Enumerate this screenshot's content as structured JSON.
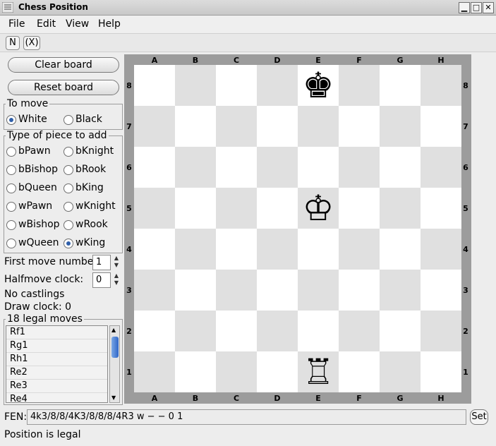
{
  "window": {
    "title": "Chess Position",
    "controls": [
      "▁",
      "□",
      "✕"
    ]
  },
  "menu": [
    "File",
    "Edit",
    "View",
    "Help"
  ],
  "toolbar": {
    "new_label": "N",
    "close_label": "(X)"
  },
  "left": {
    "clear_board": "Clear board",
    "reset_board": "Reset board",
    "to_move": {
      "title": "To move",
      "options": [
        "White",
        "Black"
      ],
      "selected": "White"
    },
    "piece_group": {
      "title": "Type of piece to add",
      "options": [
        "bPawn",
        "bKnight",
        "bBishop",
        "bRook",
        "bQueen",
        "bKing",
        "wPawn",
        "wKnight",
        "wBishop",
        "wRook",
        "wQueen",
        "wKing"
      ],
      "selected": "wKing"
    },
    "first_move_label": "First move number:",
    "first_move_value": "1",
    "halfmove_label": "Halfmove clock:",
    "halfmove_value": "0",
    "castlings": "No castlings",
    "draw_clock": "Draw clock:  0",
    "legal_moves": {
      "title": "18 legal moves",
      "items": [
        "Rf1",
        "Rg1",
        "Rh1",
        "Re2",
        "Re3",
        "Re4"
      ]
    }
  },
  "board": {
    "files": [
      "A",
      "B",
      "C",
      "D",
      "E",
      "F",
      "G",
      "H"
    ],
    "ranks": [
      "8",
      "7",
      "6",
      "5",
      "4",
      "3",
      "2",
      "1"
    ],
    "pieces": [
      {
        "square": "e8",
        "glyph": "♚",
        "name": "black-king"
      },
      {
        "square": "e5",
        "glyph": "♔",
        "name": "white-king"
      },
      {
        "square": "e1",
        "glyph": "♖",
        "name": "white-rook"
      }
    ]
  },
  "bottom": {
    "fen_label": "FEN:",
    "fen_value": "4k3/8/8/4K3/8/8/8/4R3 w − − 0 1",
    "set_label": "Set",
    "status": "Position is legal"
  }
}
